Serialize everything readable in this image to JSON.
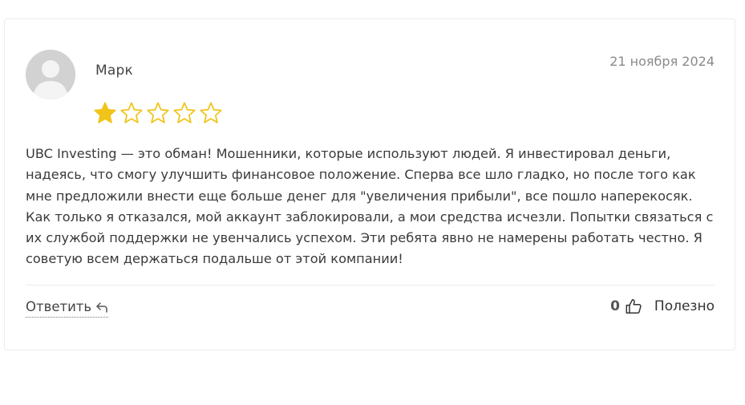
{
  "review": {
    "author": "Марк",
    "date": "21 ноября 2024",
    "rating": 1,
    "max_rating": 5,
    "text": "UBC Investing — это обман! Мошенники, которые используют людей. Я инвестировал деньги, надеясь, что смогу улучшить финансовое положение. Сперва все шло гладко, но после того как мне предложили внести еще больше денег для \"увеличения прибыли\", все пошло наперекосяк. Как только я отказался, мой аккаунт заблокировали, а мои средства исчезли. Попытки связаться с их службой поддержки не увенчались успехом. Эти ребята явно не намерены работать честно. Я советую всем держаться подальше от этой компании!"
  },
  "actions": {
    "reply_label": "Ответить",
    "helpful_count": "0",
    "helpful_label": "Полезно"
  },
  "icons": {
    "avatar": "user-placeholder-icon",
    "star_filled": "star-filled-icon",
    "star_empty": "star-outline-icon",
    "reply": "reply-arrow-icon",
    "like": "thumbs-up-icon"
  },
  "colors": {
    "star": "#f0c419",
    "text": "#3a3a3a",
    "muted": "#8a8a8a",
    "border": "#ececec"
  }
}
